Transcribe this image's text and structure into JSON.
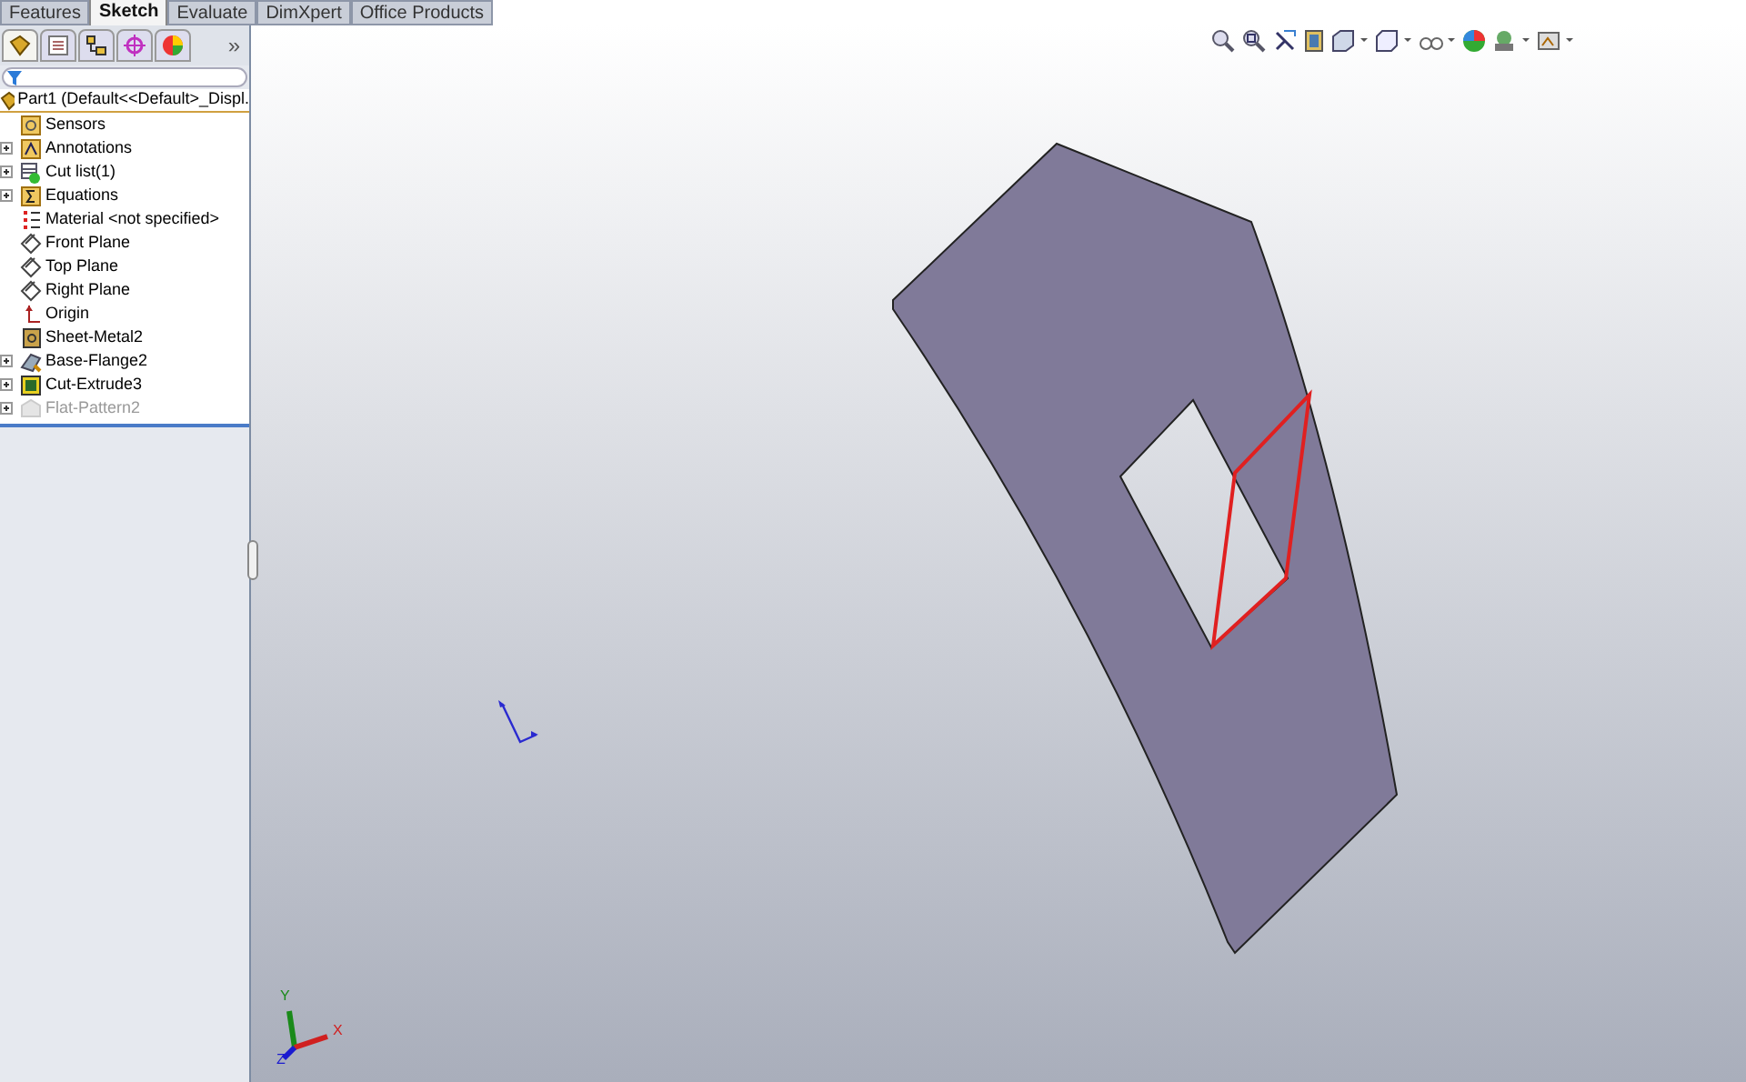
{
  "tabs": [
    {
      "label": "Features",
      "selected": false
    },
    {
      "label": "Sketch",
      "selected": true
    },
    {
      "label": "Evaluate",
      "selected": false
    },
    {
      "label": "DimXpert",
      "selected": false
    },
    {
      "label": "Office Products",
      "selected": false
    }
  ],
  "panel_overflow": "»",
  "tree": {
    "root": "Part1  (Default<<Default>_Displ.",
    "items": [
      {
        "label": "Sensors",
        "kind": "sensors",
        "expandable": false,
        "suppressed": false
      },
      {
        "label": "Annotations",
        "kind": "annotations",
        "expandable": true,
        "suppressed": false
      },
      {
        "label": "Cut list(1)",
        "kind": "cutlist",
        "expandable": true,
        "suppressed": false
      },
      {
        "label": "Equations",
        "kind": "equations",
        "expandable": true,
        "suppressed": false
      },
      {
        "label": "Material <not specified>",
        "kind": "material",
        "expandable": false,
        "suppressed": false
      },
      {
        "label": "Front Plane",
        "kind": "plane",
        "expandable": false,
        "suppressed": false
      },
      {
        "label": "Top Plane",
        "kind": "plane",
        "expandable": false,
        "suppressed": false
      },
      {
        "label": "Right Plane",
        "kind": "plane",
        "expandable": false,
        "suppressed": false
      },
      {
        "label": "Origin",
        "kind": "origin",
        "expandable": false,
        "suppressed": false
      },
      {
        "label": "Sheet-Metal2",
        "kind": "sheetmetal",
        "expandable": false,
        "suppressed": false
      },
      {
        "label": "Base-Flange2",
        "kind": "flange",
        "expandable": true,
        "suppressed": false
      },
      {
        "label": "Cut-Extrude3",
        "kind": "cut",
        "expandable": true,
        "suppressed": false
      },
      {
        "label": "Flat-Pattern2",
        "kind": "flat",
        "expandable": true,
        "suppressed": true
      }
    ]
  },
  "triad": {
    "x": "X",
    "y": "Y",
    "z": "Z"
  }
}
